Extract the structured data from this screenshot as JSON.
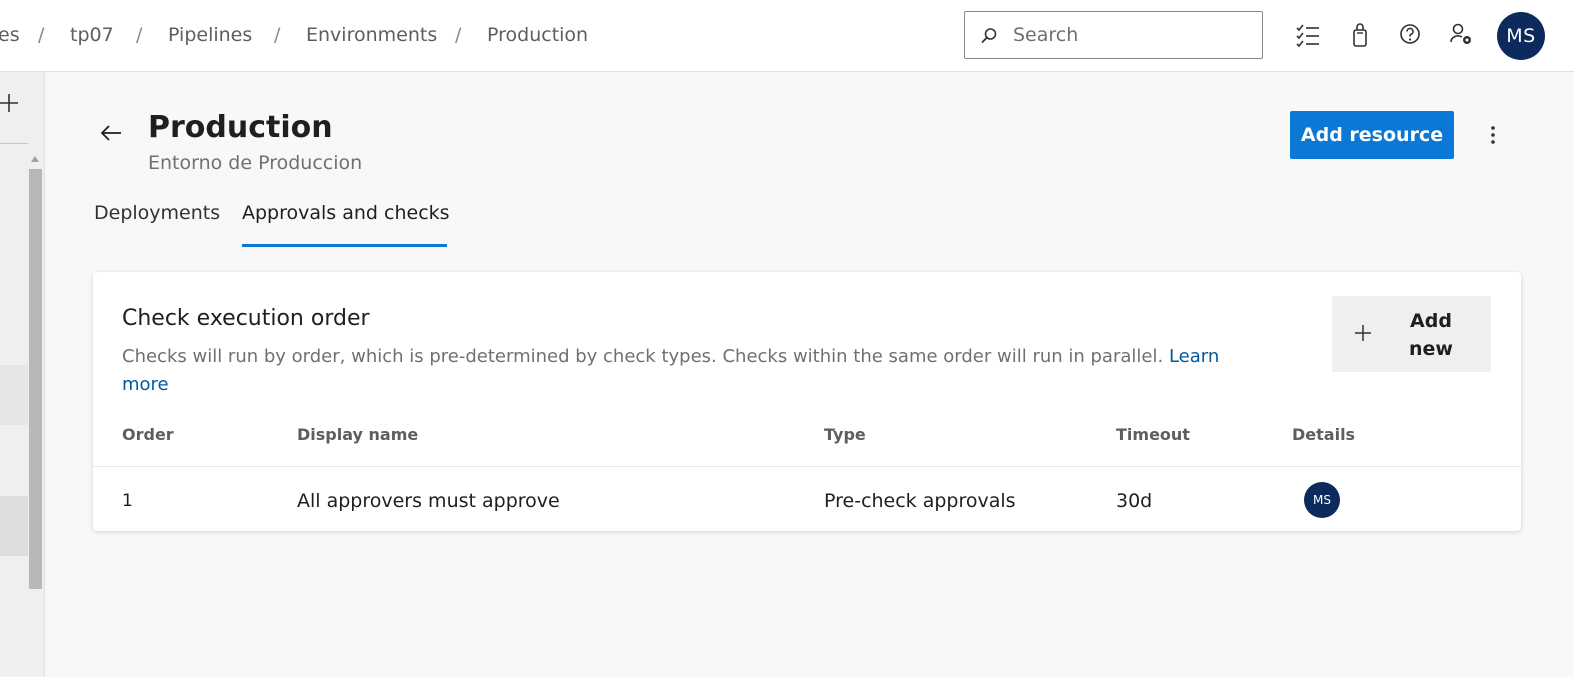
{
  "breadcrumbs": {
    "item0": "es",
    "item1": "tp07",
    "item2": "Pipelines",
    "item3": "Environments",
    "item4": "Production",
    "separator": "/"
  },
  "search": {
    "placeholder": "Search"
  },
  "toolbar_icons": [
    "checklist-icon",
    "shopping-bag-icon",
    "help-icon",
    "user-settings-icon"
  ],
  "user": {
    "initials": "MS"
  },
  "page": {
    "title": "Production",
    "subtitle": "Entorno de Produccion",
    "primary_action": "Add resource"
  },
  "tabs": {
    "deployments": "Deployments",
    "approvals": "Approvals and checks",
    "active": "approvals"
  },
  "card": {
    "title": "Check execution order",
    "description": "Checks will run by order, which is pre-determined by check types. Checks within the same order will run in parallel.",
    "learn_more": "Learn more",
    "add_new_label": "Add new",
    "columns": {
      "order": "Order",
      "display_name": "Display name",
      "type": "Type",
      "timeout": "Timeout",
      "details": "Details"
    },
    "rows": [
      {
        "order": "1",
        "display_name": "All approvers must approve",
        "type": "Pre-check approvals",
        "timeout": "30d",
        "details_initials": "MS"
      }
    ]
  },
  "colors": {
    "accent": "#0a78d4",
    "avatar": "#0d2a5c",
    "link": "#005a9e"
  }
}
